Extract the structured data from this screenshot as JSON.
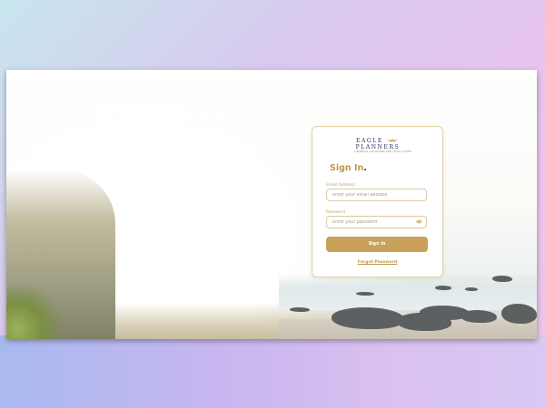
{
  "brand": {
    "name_line1": "EAGLE",
    "name_line2": "PLANNERS",
    "tagline": "FINANCIAL SOLUTIONS FOR YOUR FUTURE",
    "accent_color": "#c8a05a",
    "navy_color": "#22305a"
  },
  "signin": {
    "title": "Sign In",
    "title_dot": ".",
    "email_label": "Email Address",
    "email_placeholder": "Enter your email address",
    "email_value": "",
    "password_label": "Password",
    "password_placeholder": "Enter your password",
    "password_value": "",
    "password_toggle_icon": "eye-icon",
    "submit_label": "Sign In",
    "forgot_label": "Forgot Password"
  }
}
